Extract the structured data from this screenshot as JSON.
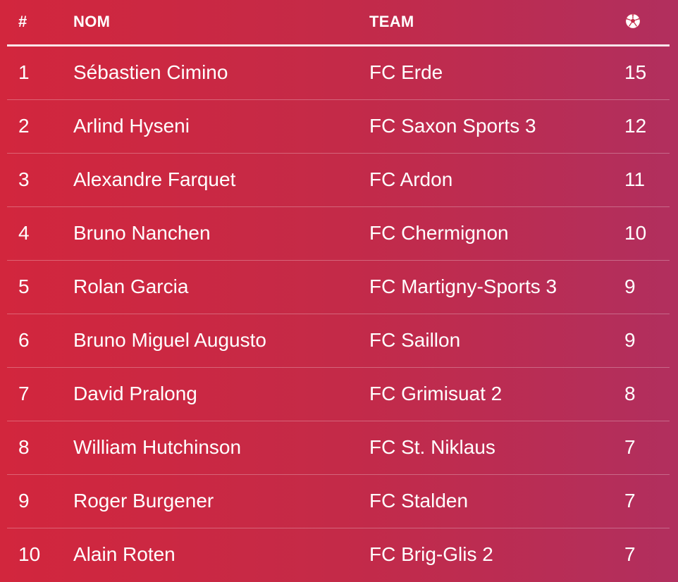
{
  "header": {
    "rank_label": "#",
    "name_label": "NOM",
    "team_label": "TEAM",
    "goals_icon": "soccer-ball-icon"
  },
  "rows": [
    {
      "rank": "1",
      "name": "Sébastien Cimino",
      "team": "FC Erde",
      "goals": "15"
    },
    {
      "rank": "2",
      "name": "Arlind Hyseni",
      "team": "FC Saxon Sports 3",
      "goals": "12"
    },
    {
      "rank": "3",
      "name": "Alexandre Farquet",
      "team": "FC Ardon",
      "goals": "11"
    },
    {
      "rank": "4",
      "name": "Bruno Nanchen",
      "team": "FC Chermignon",
      "goals": "10"
    },
    {
      "rank": "5",
      "name": "Rolan Garcia",
      "team": "FC Martigny-Sports 3",
      "goals": "9"
    },
    {
      "rank": "6",
      "name": "Bruno Miguel Augusto",
      "team": "FC Saillon",
      "goals": "9"
    },
    {
      "rank": "7",
      "name": "David Pralong",
      "team": "FC Grimisuat 2",
      "goals": "8"
    },
    {
      "rank": "8",
      "name": "William Hutchinson",
      "team": "FC St. Niklaus",
      "goals": "7"
    },
    {
      "rank": "9",
      "name": "Roger Burgener",
      "team": "FC Stalden",
      "goals": "7"
    },
    {
      "rank": "10",
      "name": "Alain Roten",
      "team": "FC Brig-Glis 2",
      "goals": "7"
    }
  ],
  "colors": {
    "gradient_start": "#d2263d",
    "gradient_end": "#b12f5e",
    "text": "#ffffff"
  }
}
